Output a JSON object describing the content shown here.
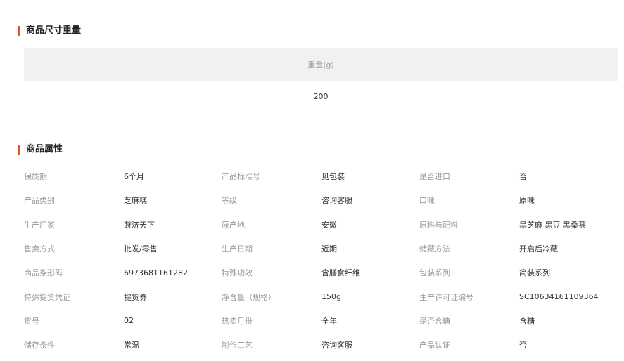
{
  "sections": {
    "size_title": "商品尺寸重量",
    "attr_title": "商品属性"
  },
  "size_table": {
    "header": "重量(g)",
    "value": "200"
  },
  "attributes": [
    [
      {
        "label": "保质期",
        "value": "6个月"
      },
      {
        "label": "产品标准号",
        "value": "见包装"
      },
      {
        "label": "是否进口",
        "value": "否"
      }
    ],
    [
      {
        "label": "产品类别",
        "value": "芝麻糕"
      },
      {
        "label": "等级",
        "value": "咨询客服"
      },
      {
        "label": "口味",
        "value": "原味"
      }
    ],
    [
      {
        "label": "生产厂家",
        "value": "莳济天下"
      },
      {
        "label": "原产地",
        "value": "安徽"
      },
      {
        "label": "原料与配料",
        "value": "黑芝麻 黑豆 黑桑葚"
      }
    ],
    [
      {
        "label": "售卖方式",
        "value": "批发/零售"
      },
      {
        "label": "生产日期",
        "value": "近期"
      },
      {
        "label": "储藏方法",
        "value": "开启后冷藏"
      }
    ],
    [
      {
        "label": "商品条形码",
        "value": "6973681161282"
      },
      {
        "label": "特殊功效",
        "value": "含膳食纤维"
      },
      {
        "label": "包装系列",
        "value": "简装系列"
      }
    ],
    [
      {
        "label": "特殊提货凭证",
        "value": "提货券"
      },
      {
        "label": "净含量（规格）",
        "value": "150g"
      },
      {
        "label": "生产许可证编号",
        "value": "SC10634161109364"
      }
    ],
    [
      {
        "label": "货号",
        "value": "02"
      },
      {
        "label": "热卖月份",
        "value": "全年"
      },
      {
        "label": "是否含糖",
        "value": "含糖"
      }
    ],
    [
      {
        "label": "储存条件",
        "value": "常温"
      },
      {
        "label": "制作工艺",
        "value": "咨询客服"
      },
      {
        "label": "产品认证",
        "value": "否"
      }
    ]
  ]
}
